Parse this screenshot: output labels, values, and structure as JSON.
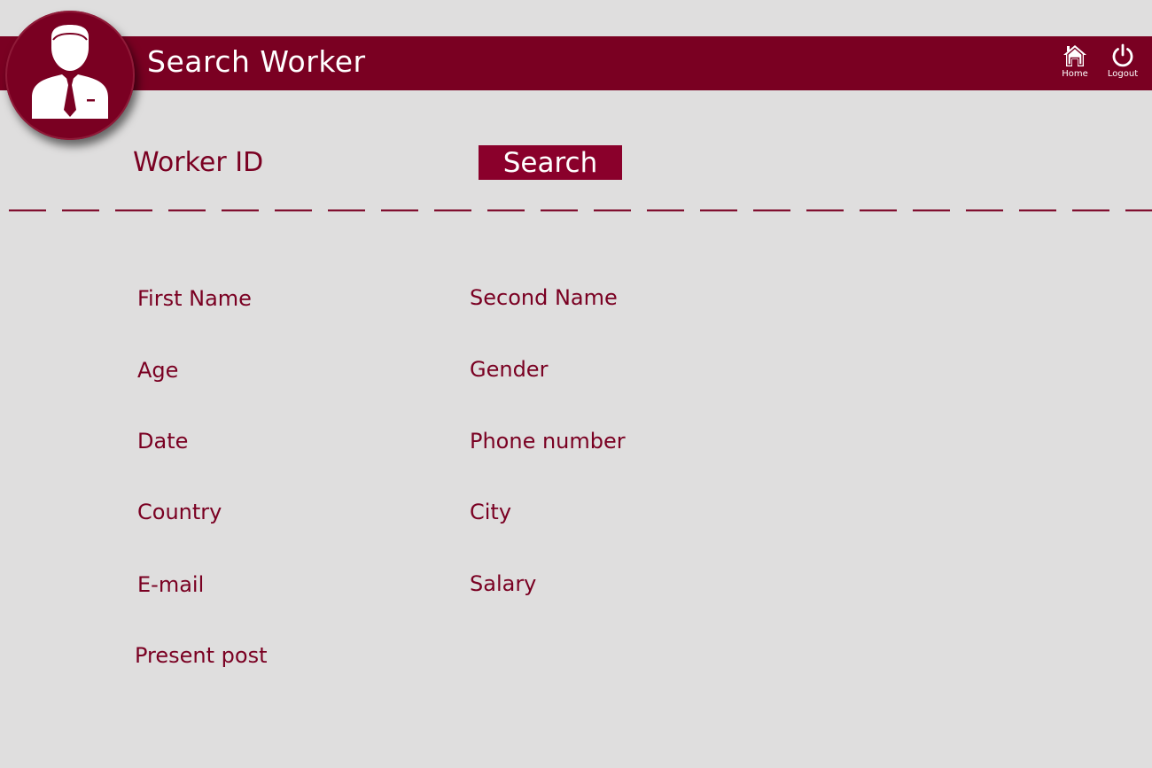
{
  "header": {
    "title": "Search Worker",
    "nav": {
      "home_label": "Home",
      "home_icon": "home-icon",
      "logout_label": "Logout",
      "logout_icon": "power-icon"
    }
  },
  "avatar": {
    "icon": "worker-avatar-icon"
  },
  "search": {
    "label": "Worker ID",
    "button_label": "Search"
  },
  "fields": {
    "first_name": "First Name",
    "second_name": "Second Name",
    "age": "Age",
    "gender": "Gender",
    "date": "Date",
    "phone_number": "Phone number",
    "country": "Country",
    "city": "City",
    "email": "E-mail",
    "salary": "Salary",
    "present_post": "Present post"
  },
  "colors": {
    "accent": "#7a0022",
    "button": "#8a002b",
    "background": "#dfdede",
    "text_on_accent": "#ffffff"
  }
}
